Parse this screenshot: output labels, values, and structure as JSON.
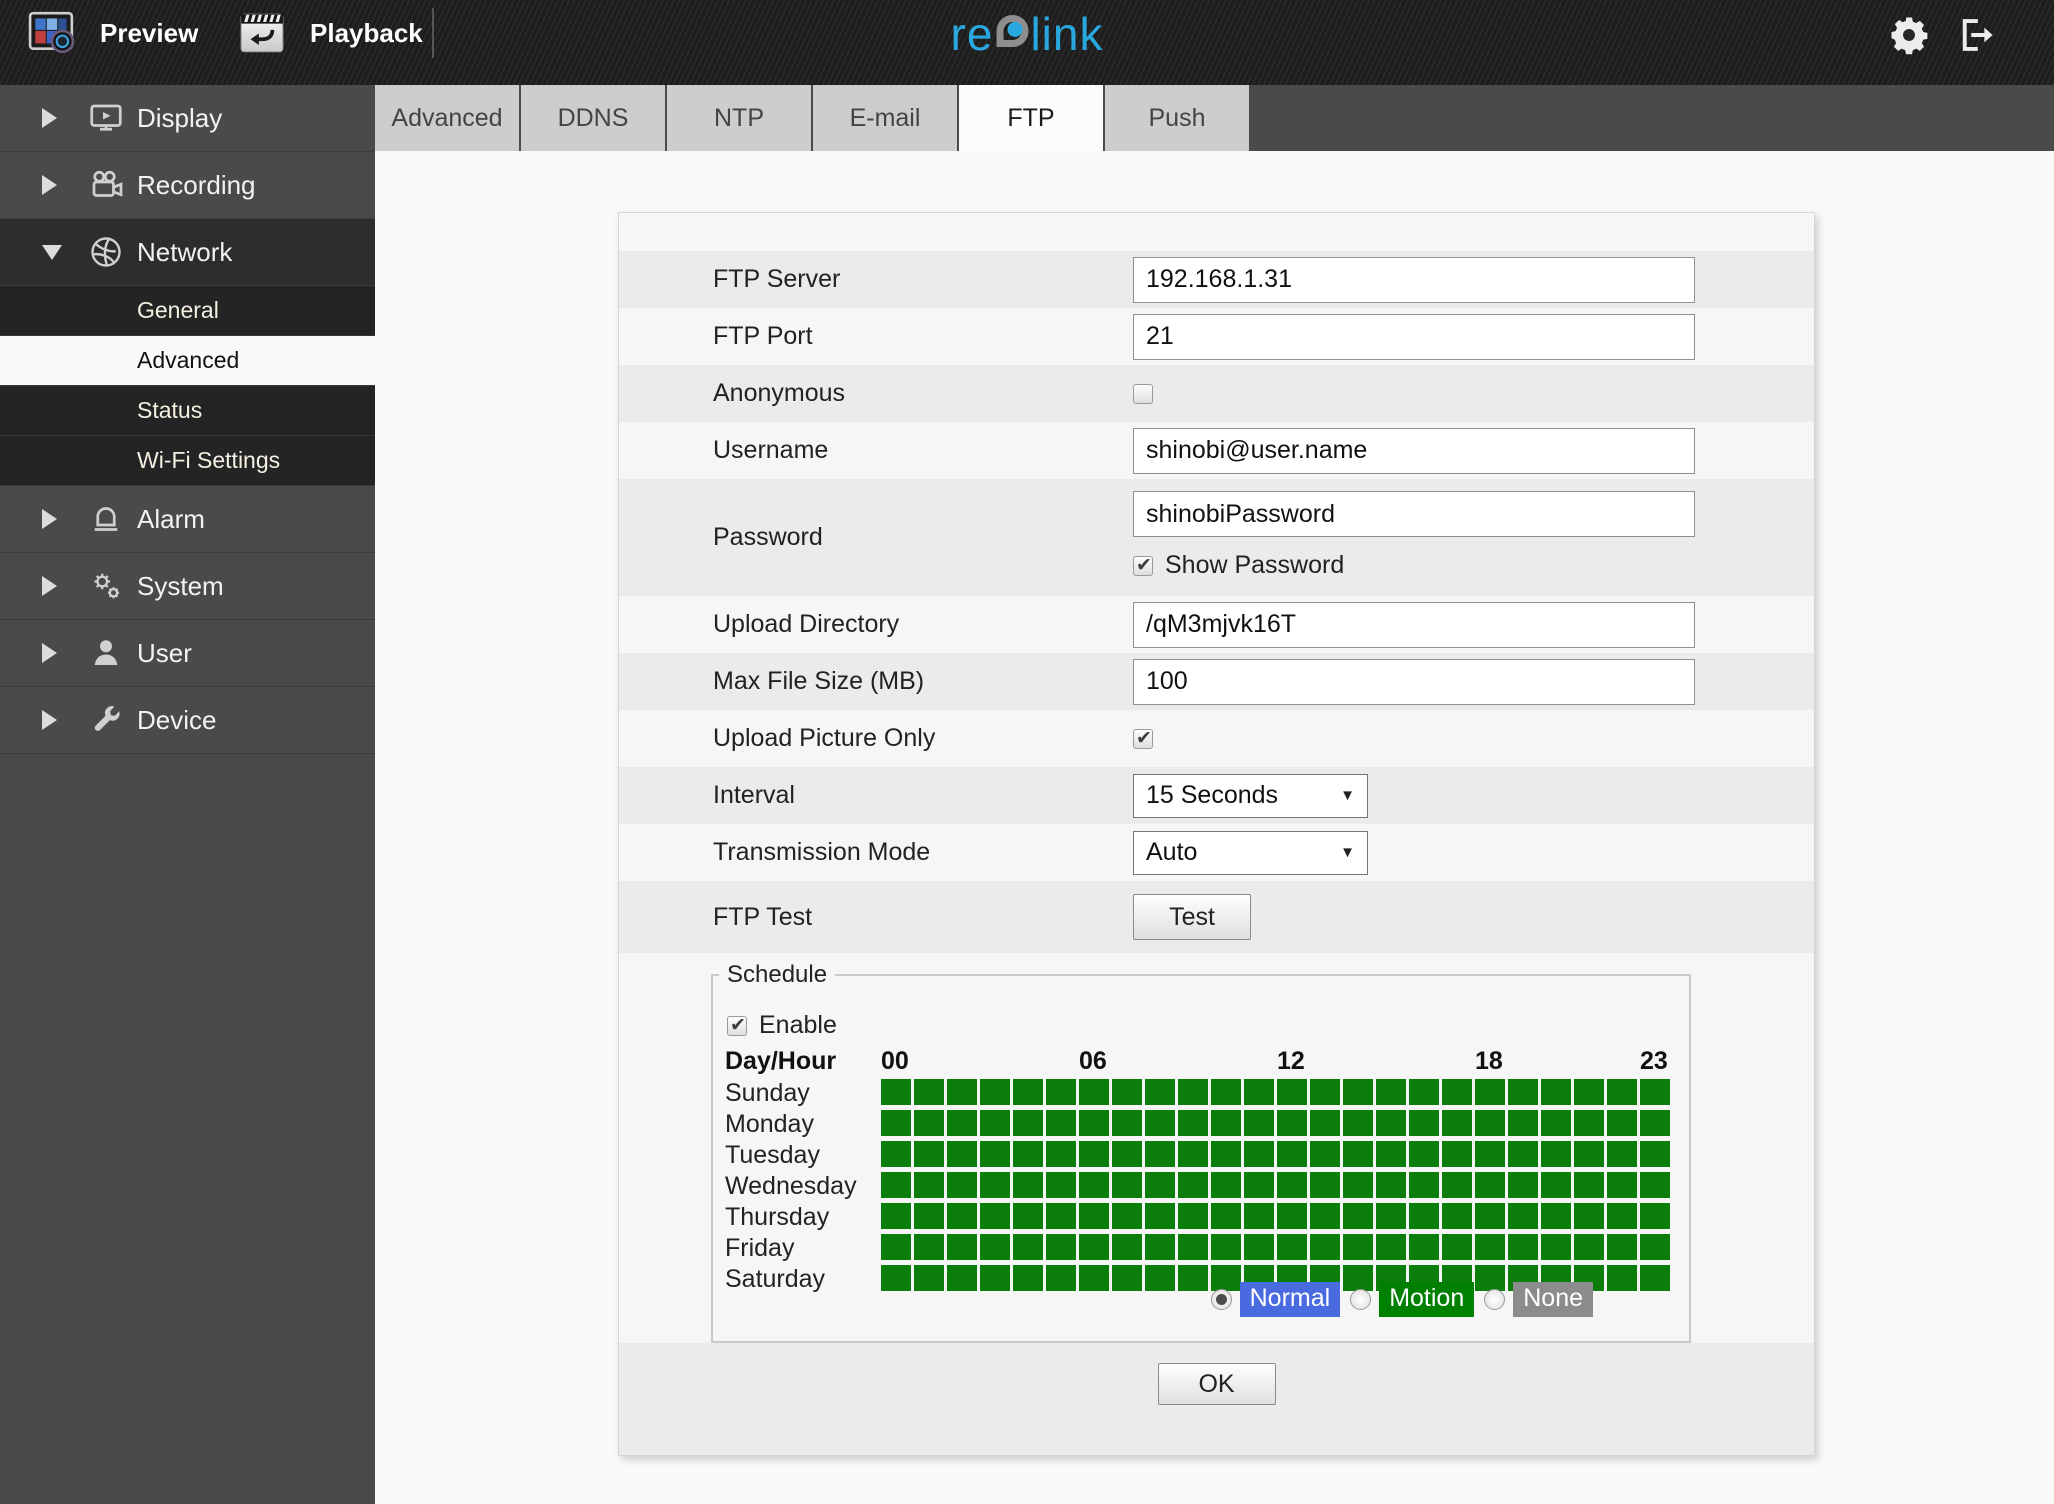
{
  "topbar": {
    "preview_label": "Preview",
    "playback_label": "Playback",
    "logo": {
      "part1": "re",
      "part2": "link"
    }
  },
  "sidebar": {
    "items": [
      {
        "label": "Display",
        "state": "collapsed"
      },
      {
        "label": "Recording",
        "state": "collapsed"
      },
      {
        "label": "Network",
        "state": "expanded"
      },
      {
        "label": "Alarm",
        "state": "collapsed"
      },
      {
        "label": "System",
        "state": "collapsed"
      },
      {
        "label": "User",
        "state": "collapsed"
      },
      {
        "label": "Device",
        "state": "collapsed"
      }
    ],
    "network_subitems": [
      {
        "label": "General",
        "selected": false
      },
      {
        "label": "Advanced",
        "selected": true
      },
      {
        "label": "Status",
        "selected": false
      },
      {
        "label": "Wi-Fi Settings",
        "selected": false
      }
    ]
  },
  "tabs": {
    "items": [
      "Advanced",
      "DDNS",
      "NTP",
      "E-mail",
      "FTP",
      "Push"
    ],
    "active": "FTP"
  },
  "form": {
    "ftp_server": {
      "label": "FTP Server",
      "value": "192.168.1.31"
    },
    "ftp_port": {
      "label": "FTP Port",
      "value": "21"
    },
    "anonymous": {
      "label": "Anonymous",
      "checked": false
    },
    "username": {
      "label": "Username",
      "value": "shinobi@user.name"
    },
    "password": {
      "label": "Password",
      "value": "shinobiPassword",
      "show_password_label": "Show Password",
      "show_password_checked": true
    },
    "upload_directory": {
      "label": "Upload Directory",
      "value": "/qM3mjvk16T"
    },
    "max_file_size": {
      "label": "Max File Size (MB)",
      "value": "100"
    },
    "upload_picture_only": {
      "label": "Upload Picture Only",
      "checked": true
    },
    "interval": {
      "label": "Interval",
      "value": "15 Seconds"
    },
    "transmission_mode": {
      "label": "Transmission Mode",
      "value": "Auto"
    },
    "ftp_test": {
      "label": "FTP Test",
      "button": "Test"
    }
  },
  "schedule": {
    "legend": "Schedule",
    "enable_label": "Enable",
    "enable_checked": true,
    "corner_label": "Day/Hour",
    "hour_labels": [
      "00",
      "06",
      "12",
      "18",
      "23"
    ],
    "hour_columns": [
      0,
      6,
      12,
      18,
      23
    ],
    "days": [
      "Sunday",
      "Monday",
      "Tuesday",
      "Wednesday",
      "Thursday",
      "Friday",
      "Saturday"
    ],
    "columns": 24,
    "cell_color": "#0a7d0a",
    "all_cells_selected": true,
    "modes": [
      {
        "label": "Normal",
        "color": "#4a6be0",
        "selected": true
      },
      {
        "label": "Motion",
        "color": "#008000",
        "selected": false
      },
      {
        "label": "None",
        "color": "#8c8c8c",
        "selected": false
      }
    ]
  },
  "ok_label": "OK"
}
